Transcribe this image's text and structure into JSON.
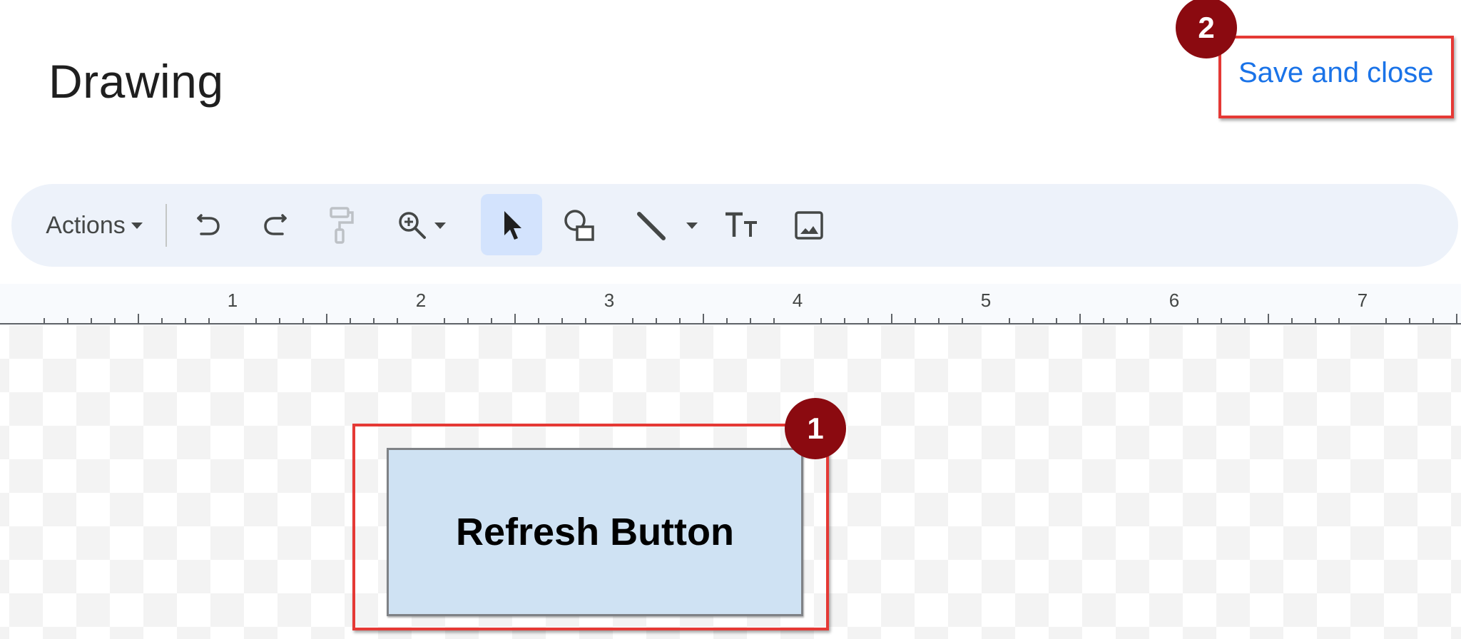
{
  "header": {
    "title": "Drawing",
    "save_label": "Save and close"
  },
  "toolbar": {
    "actions_label": "Actions",
    "icons": [
      "undo-icon",
      "redo-icon",
      "paint-format-icon",
      "zoom-icon",
      "select-icon",
      "shape-icon",
      "line-icon",
      "text-box-icon",
      "image-icon"
    ]
  },
  "ruler": {
    "labels": [
      "1",
      "2",
      "3",
      "4",
      "5",
      "6",
      "7"
    ]
  },
  "canvas": {
    "shape_text": "Refresh Button"
  },
  "annotations": {
    "badge_1": "1",
    "badge_2": "2",
    "highlight_color": "#e53935",
    "badge_color": "#8b0a10"
  }
}
